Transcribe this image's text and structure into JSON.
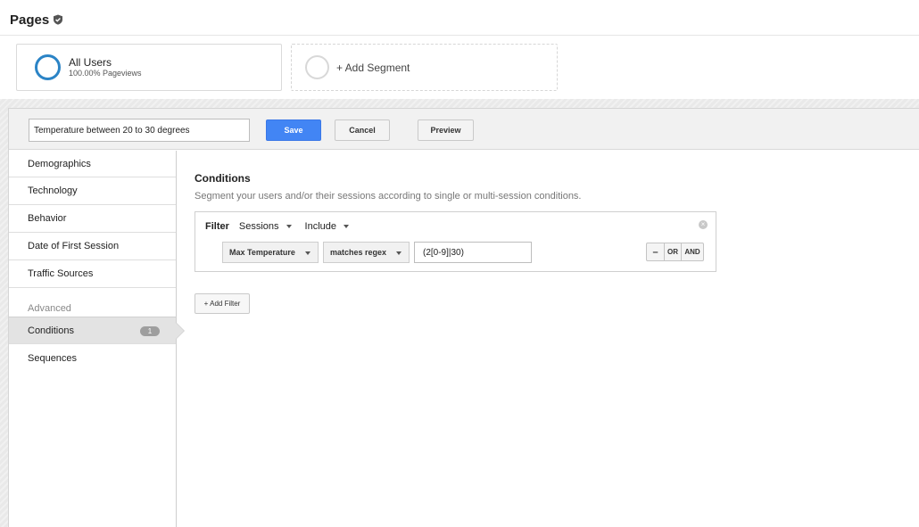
{
  "page": {
    "title": "Pages"
  },
  "segments": [
    {
      "name": "All Users",
      "subtitle": "100.00% Pageviews"
    },
    {
      "name": "+ Add Segment"
    }
  ],
  "editor": {
    "segment_name": "Temperature between 20 to 30 degrees",
    "save_label": "Save",
    "cancel_label": "Cancel",
    "preview_label": "Preview"
  },
  "sidebar": {
    "items": [
      {
        "label": "Demographics"
      },
      {
        "label": "Technology"
      },
      {
        "label": "Behavior"
      },
      {
        "label": "Date of First Session"
      },
      {
        "label": "Traffic Sources"
      }
    ],
    "advanced_label": "Advanced",
    "advanced_items": [
      {
        "label": "Conditions",
        "badge": "1",
        "active": true
      },
      {
        "label": "Sequences"
      }
    ]
  },
  "main": {
    "title": "Conditions",
    "description": "Segment your users and/or their sessions according to single or multi-session conditions.",
    "filter": {
      "label": "Filter",
      "scope": "Sessions",
      "mode": "Include",
      "dimension": "Max Temperature",
      "operator": "matches regex",
      "value": "(2[0-9]|30)",
      "remove_label": "–",
      "or_label": "OR",
      "and_label": "AND"
    },
    "add_filter_label": "+ Add Filter"
  },
  "colors": {
    "accent": "#4285f4",
    "segment_ring": "#2b84c6"
  }
}
